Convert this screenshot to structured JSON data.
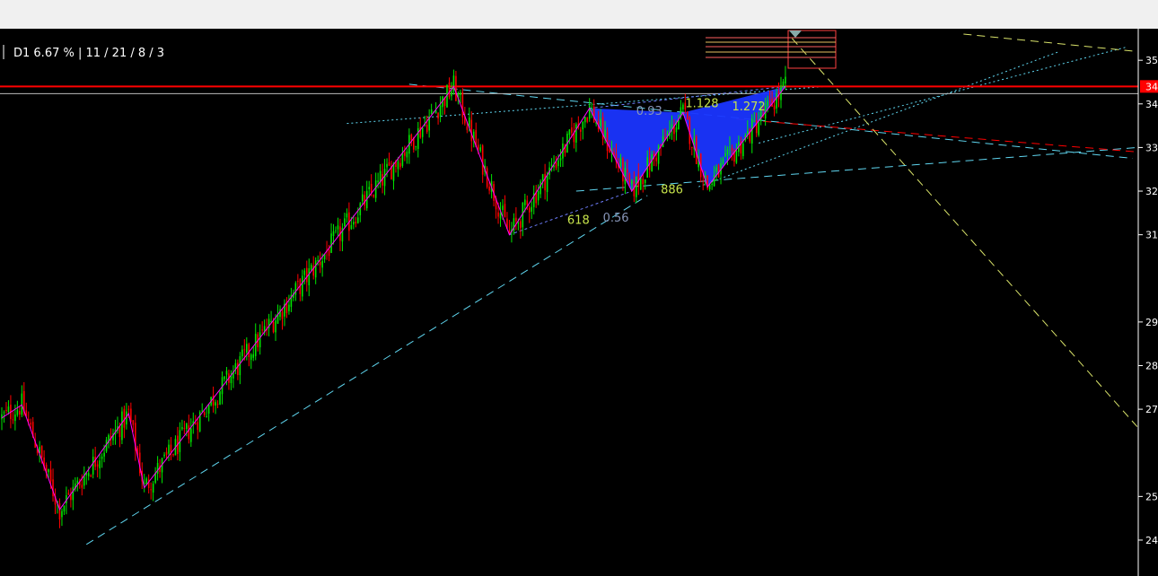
{
  "header": {
    "info_text": "D1  6.67 % | 11 / 21 / 8 / 3"
  },
  "colors": {
    "background": "#000000",
    "bull_candle": "#00e600",
    "bear_candle": "#ff0000",
    "zigzag": "#ff00ff",
    "pattern_fill": "#1a35ff",
    "trend_cyan": "#5fd6f0",
    "resistance_red": "#ff0000",
    "fib_label": "#c6e34b",
    "ratio_label": "#8896b8",
    "projection_yellow": "#d9e36a",
    "axis_text": "#ffffff"
  },
  "chart_data": {
    "type": "candlestick",
    "timeframe": "D1",
    "ylim": [
      23.3,
      35.6
    ],
    "y_ticks": [
      "35",
      "34",
      "33",
      "32",
      "31",
      "29",
      "28",
      "27",
      "25",
      "24"
    ],
    "y_tick_values": [
      35.0,
      34.0,
      33.0,
      32.0,
      31.0,
      29.0,
      28.0,
      27.0,
      25.0,
      24.0
    ],
    "current_price_label": "34",
    "current_price": 34.4,
    "resistance_level": 34.4,
    "zigzag_points": [
      {
        "bar": 0,
        "price": 26.8
      },
      {
        "bar": 9,
        "price": 27.1
      },
      {
        "bar": 26,
        "price": 24.7
      },
      {
        "bar": 57,
        "price": 26.9
      },
      {
        "bar": 64,
        "price": 25.2
      },
      {
        "bar": 203,
        "price": 34.4
      },
      {
        "bar": 228,
        "price": 31.0
      },
      {
        "bar": 264,
        "price": 33.9
      },
      {
        "bar": 283,
        "price": 32.0
      },
      {
        "bar": 306,
        "price": 33.8
      },
      {
        "bar": 317,
        "price": 32.1
      },
      {
        "bar": 352,
        "price": 34.4
      }
    ],
    "harmonic_ratios": [
      {
        "text": "0.93",
        "bar": 285,
        "price": 33.75,
        "kind": "ratio"
      },
      {
        "text": "1.128",
        "bar": 307,
        "price": 33.92,
        "kind": "fib"
      },
      {
        "text": "1.272",
        "bar": 328,
        "price": 33.85,
        "kind": "fib"
      },
      {
        "text": "886",
        "bar": 296,
        "price": 31.95,
        "kind": "fib"
      },
      {
        "text": "618",
        "bar": 254,
        "price": 31.25,
        "kind": "fib"
      },
      {
        "text": "0.56",
        "bar": 270,
        "price": 31.3,
        "kind": "ratio"
      }
    ],
    "trendlines": [
      {
        "name": "lower-support-cyan",
        "style": "dash",
        "color": "trend_cyan",
        "from": {
          "bar": 38,
          "price": 23.9
        },
        "to": {
          "bar": 290,
          "price": 31.9
        }
      },
      {
        "name": "base-support-cyan",
        "style": "dash",
        "color": "trend_cyan",
        "from": {
          "bar": 258,
          "price": 32.0
        },
        "to": {
          "bar": 510,
          "price": 33.0
        }
      },
      {
        "name": "upper-channel-cyan",
        "style": "dash",
        "color": "trend_cyan",
        "from": {
          "bar": 183,
          "price": 34.45
        },
        "to": {
          "bar": 508,
          "price": 32.75
        }
      },
      {
        "name": "dotted-rise-1",
        "style": "dot",
        "color": "trend_cyan",
        "from": {
          "bar": 155,
          "price": 33.55
        },
        "to": {
          "bar": 370,
          "price": 34.4
        }
      },
      {
        "name": "dotted-rise-2",
        "style": "dot",
        "color": "trend_cyan",
        "from": {
          "bar": 313,
          "price": 32.1
        },
        "to": {
          "bar": 475,
          "price": 35.2
        }
      },
      {
        "name": "dotted-rise-3",
        "style": "dot",
        "color": "trend_cyan",
        "from": {
          "bar": 340,
          "price": 33.1
        },
        "to": {
          "bar": 505,
          "price": 35.3
        }
      },
      {
        "name": "red-dash-decline",
        "style": "dash",
        "color": "resistance_red",
        "from": {
          "bar": 330,
          "price": 33.65
        },
        "to": {
          "bar": 510,
          "price": 32.9
        }
      },
      {
        "name": "yellow-projection",
        "style": "dash",
        "color": "projection_yellow",
        "from": {
          "bar": 355,
          "price": 35.5
        },
        "to": {
          "bar": 510,
          "price": 26.6
        }
      },
      {
        "name": "yellow-top",
        "style": "dash",
        "color": "projection_yellow",
        "from": {
          "bar": 432,
          "price": 35.6
        },
        "to": {
          "bar": 510,
          "price": 35.2
        }
      }
    ]
  }
}
